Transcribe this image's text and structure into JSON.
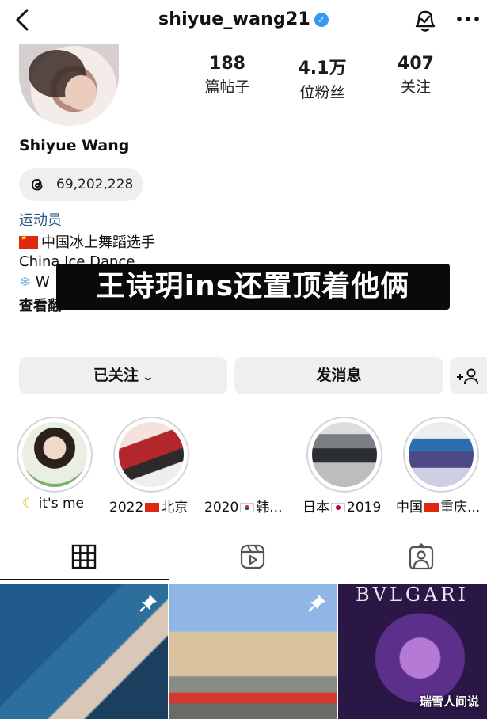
{
  "header": {
    "username": "shiyue_wang21"
  },
  "profile": {
    "stats": [
      {
        "value": "188",
        "label": "篇帖子"
      },
      {
        "value": "4.1万",
        "label": "位粉丝"
      },
      {
        "value": "407",
        "label": "关注"
      }
    ],
    "display_name": "Shiyue Wang",
    "threads_count": "69,202,228",
    "bio": {
      "category": "运动员",
      "line1": "中国冰上舞蹈选手",
      "line2": "China  Ice Dance",
      "line3": "W",
      "more": "查看翻"
    }
  },
  "caption": "王诗玥ins还置顶着他俩",
  "actions": {
    "following": "已关注",
    "message": "发消息"
  },
  "highlights": [
    {
      "label": "it's me"
    },
    {
      "label_a": "2022",
      "label_b": "北京"
    },
    {
      "label_a": "2020",
      "label_b": "韩..."
    },
    {
      "label_a": "日本",
      "label_b": "2019"
    },
    {
      "label_a": "中国",
      "label_b": "重庆..."
    }
  ],
  "posts": {
    "brand_text": "BVLGARI",
    "watermark": "瑞雪人间说"
  }
}
